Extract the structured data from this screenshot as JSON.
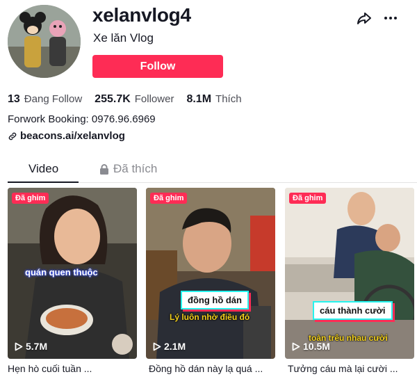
{
  "profile": {
    "username": "xelanvlog4",
    "nickname": "Xe lăn Vlog",
    "follow_label": "Follow",
    "following_count": "13",
    "following_label": "Đang Follow",
    "followers_count": "255.7K",
    "followers_label": "Follower",
    "likes_count": "8.1M",
    "likes_label": "Thích",
    "bio": "Forwork Booking: 0976.96.6969",
    "link": "beacons.ai/xelanvlog"
  },
  "tabs": [
    {
      "label": "Video"
    },
    {
      "label": "Đã thích"
    }
  ],
  "videos": [
    {
      "pinned": "Đã ghim",
      "overlay": "quán quen thuộc",
      "views": "5.7M",
      "caption": "Hẹn hò cuối tuần ..."
    },
    {
      "pinned": "Đã ghim",
      "overlay": "đồng hồ dán",
      "overlay2": "Lý luôn nhờ điều đó",
      "views": "2.1M",
      "caption": "Đồng hồ dán này lạ quá ..."
    },
    {
      "pinned": "Đã ghim",
      "overlay": "cáu thành cười",
      "overlay2": "toàn trêu nhau cười",
      "views": "10.5M",
      "caption": "Tưởng cáu mà lại cười ..."
    }
  ],
  "colors": {
    "accent": "#fe2c55",
    "text": "#161823",
    "muted": "#8a8b91"
  },
  "icons": [
    "share-icon",
    "more-icon",
    "link-icon",
    "lock-icon",
    "play-icon"
  ]
}
